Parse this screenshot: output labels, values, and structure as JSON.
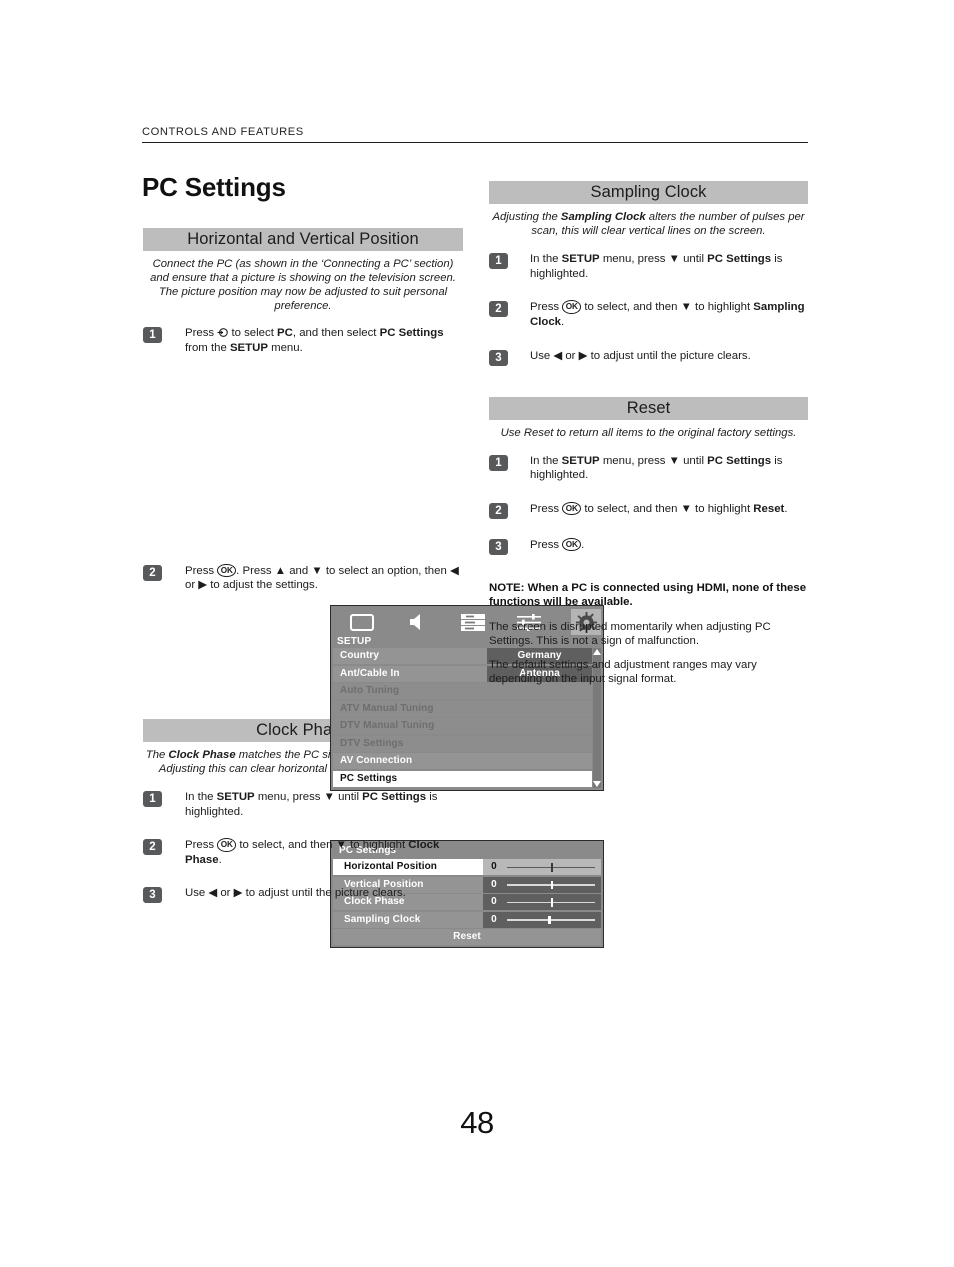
{
  "header": {
    "running_head": "CONTROLS AND FEATURES",
    "page_title": "PC Settings"
  },
  "footer": {
    "page_number": "48"
  },
  "left_column": {
    "section": {
      "heading": "Horizontal and Vertical Position",
      "intro_line1": "Connect the PC (as shown in the ‘Connecting a PC’ section)",
      "intro_line2": "and ensure that a picture is showing on the television screen.",
      "intro_line3": "The picture position may now be adjusted to suit personal",
      "intro_line4": "preference.",
      "steps": [
        {
          "number": "1",
          "text_a": "Press ",
          "text_b": " to select ",
          "bold_1": "PC",
          "text_c": ", and then select ",
          "bold_2": "PC Settings",
          "text_d": " from the ",
          "bold_3": "SETUP",
          "text_e": " menu."
        },
        {
          "number": "2",
          "text_a": "Press ",
          "ok": "OK",
          "text_b": ". Press ▲ and ▼ to select an option, then ◀ or ▶ to adjust the settings."
        }
      ]
    },
    "setup_menu": {
      "menu_label": "SETUP",
      "icons": [
        {
          "name": "picture-icon",
          "label": "Picture"
        },
        {
          "name": "sound-icon",
          "label": "Sound"
        },
        {
          "name": "features-icon",
          "label": "Features"
        },
        {
          "name": "preferences-icon",
          "label": "Preferences"
        },
        {
          "name": "setup-gear-icon",
          "label": "Setup"
        }
      ],
      "active_icon_index": 4,
      "rows": [
        {
          "name": "Country",
          "value": "Germany",
          "state": "normal"
        },
        {
          "name": "Ant/Cable In",
          "value": "Antenna",
          "state": "normal"
        },
        {
          "name": "Auto Tuning",
          "value": "",
          "state": "dim"
        },
        {
          "name": "ATV Manual Tuning",
          "value": "",
          "state": "dim"
        },
        {
          "name": "DTV Manual Tuning",
          "value": "",
          "state": "dim"
        },
        {
          "name": "DTV Settings",
          "value": "",
          "state": "dim"
        },
        {
          "name": "AV Connection",
          "value": "",
          "state": "normal"
        },
        {
          "name": "PC Settings",
          "value": "",
          "state": "selected"
        }
      ]
    },
    "pc_settings_menu": {
      "title": "PC Settings",
      "rows": [
        {
          "name": "Horizontal Position",
          "value": "0",
          "knob_pct": 50,
          "state": "selected"
        },
        {
          "name": "Vertical Position",
          "value": "0",
          "knob_pct": 50,
          "state": "normal"
        },
        {
          "name": "Clock Phase",
          "value": "0",
          "knob_pct": 50,
          "state": "normal"
        },
        {
          "name": "Sampling Clock",
          "value": "0",
          "knob_pct": 46,
          "state": "normal"
        }
      ],
      "reset_label": "Reset"
    },
    "clock_phase": {
      "heading": "Clock Phase",
      "intro_a": "The ",
      "intro_bold": "Clock Phase",
      "intro_b": " matches the PC signal with the LCD display. Adjusting this can clear horizontal stripes and picture blur.",
      "steps": [
        {
          "number": "1",
          "part_a": "In the ",
          "bold_1": "SETUP",
          "part_b": " menu, press ▼ until ",
          "bold_2": "PC Settings",
          "part_c": " is highlighted."
        },
        {
          "number": "2",
          "part_a": "Press ",
          "ok": "OK",
          "part_b": " to select, and then ▼ to highlight ",
          "bold_1": "Clock Phase",
          "part_c": "."
        },
        {
          "number": "3",
          "part_a": "Use ◀ or ▶ to adjust until the picture clears."
        }
      ]
    }
  },
  "right_column": {
    "sampling_clock": {
      "heading": "Sampling Clock",
      "intro_a": "Adjusting the ",
      "intro_bold": "Sampling Clock",
      "intro_b": " alters the number of pulses per scan, this will clear vertical lines on the screen.",
      "steps": [
        {
          "number": "1",
          "part_a": "In the ",
          "bold_1": "SETUP",
          "part_b": " menu, press ▼ until ",
          "bold_2": "PC Settings",
          "part_c": " is highlighted."
        },
        {
          "number": "2",
          "part_a": "Press ",
          "ok": "OK",
          "part_b": " to select, and then ▼ to highlight ",
          "bold_1": "Sampling Clock",
          "part_c": "."
        },
        {
          "number": "3",
          "part_a": "Use ◀ or ▶ to adjust until the picture clears."
        }
      ]
    },
    "reset": {
      "heading": "Reset",
      "intro": "Use Reset to return all items to the original factory settings.",
      "steps": [
        {
          "number": "1",
          "part_a": "In the ",
          "bold_1": "SETUP",
          "part_b": " menu, press ▼ until ",
          "bold_2": "PC Settings",
          "part_c": " is highlighted."
        },
        {
          "number": "2",
          "part_a": "Press ",
          "ok": "OK",
          "part_b": " to select, and then ▼ to highlight ",
          "bold_1": "Reset",
          "part_c": "."
        },
        {
          "number": "3",
          "part_a": "Press ",
          "ok": "OK",
          "part_b": "."
        }
      ]
    },
    "notes": {
      "note_bold": "NOTE: When a PC is connected using HDMI, none of these functions will be available.",
      "paragraph_1": "The screen is disrupted momentarily when adjusting PC Settings. This is not a sign of malfunction.",
      "paragraph_2": "The default settings and adjustment ranges may vary depending on the input signal format."
    }
  },
  "colors": {
    "section_bar": "#bdbdbd",
    "step_badge": "#58595b",
    "osd_background": "#8a8a8a",
    "osd_row_name": "#949494",
    "osd_row_value": "#5f5f5f",
    "osd_selected": "#ffffff"
  }
}
